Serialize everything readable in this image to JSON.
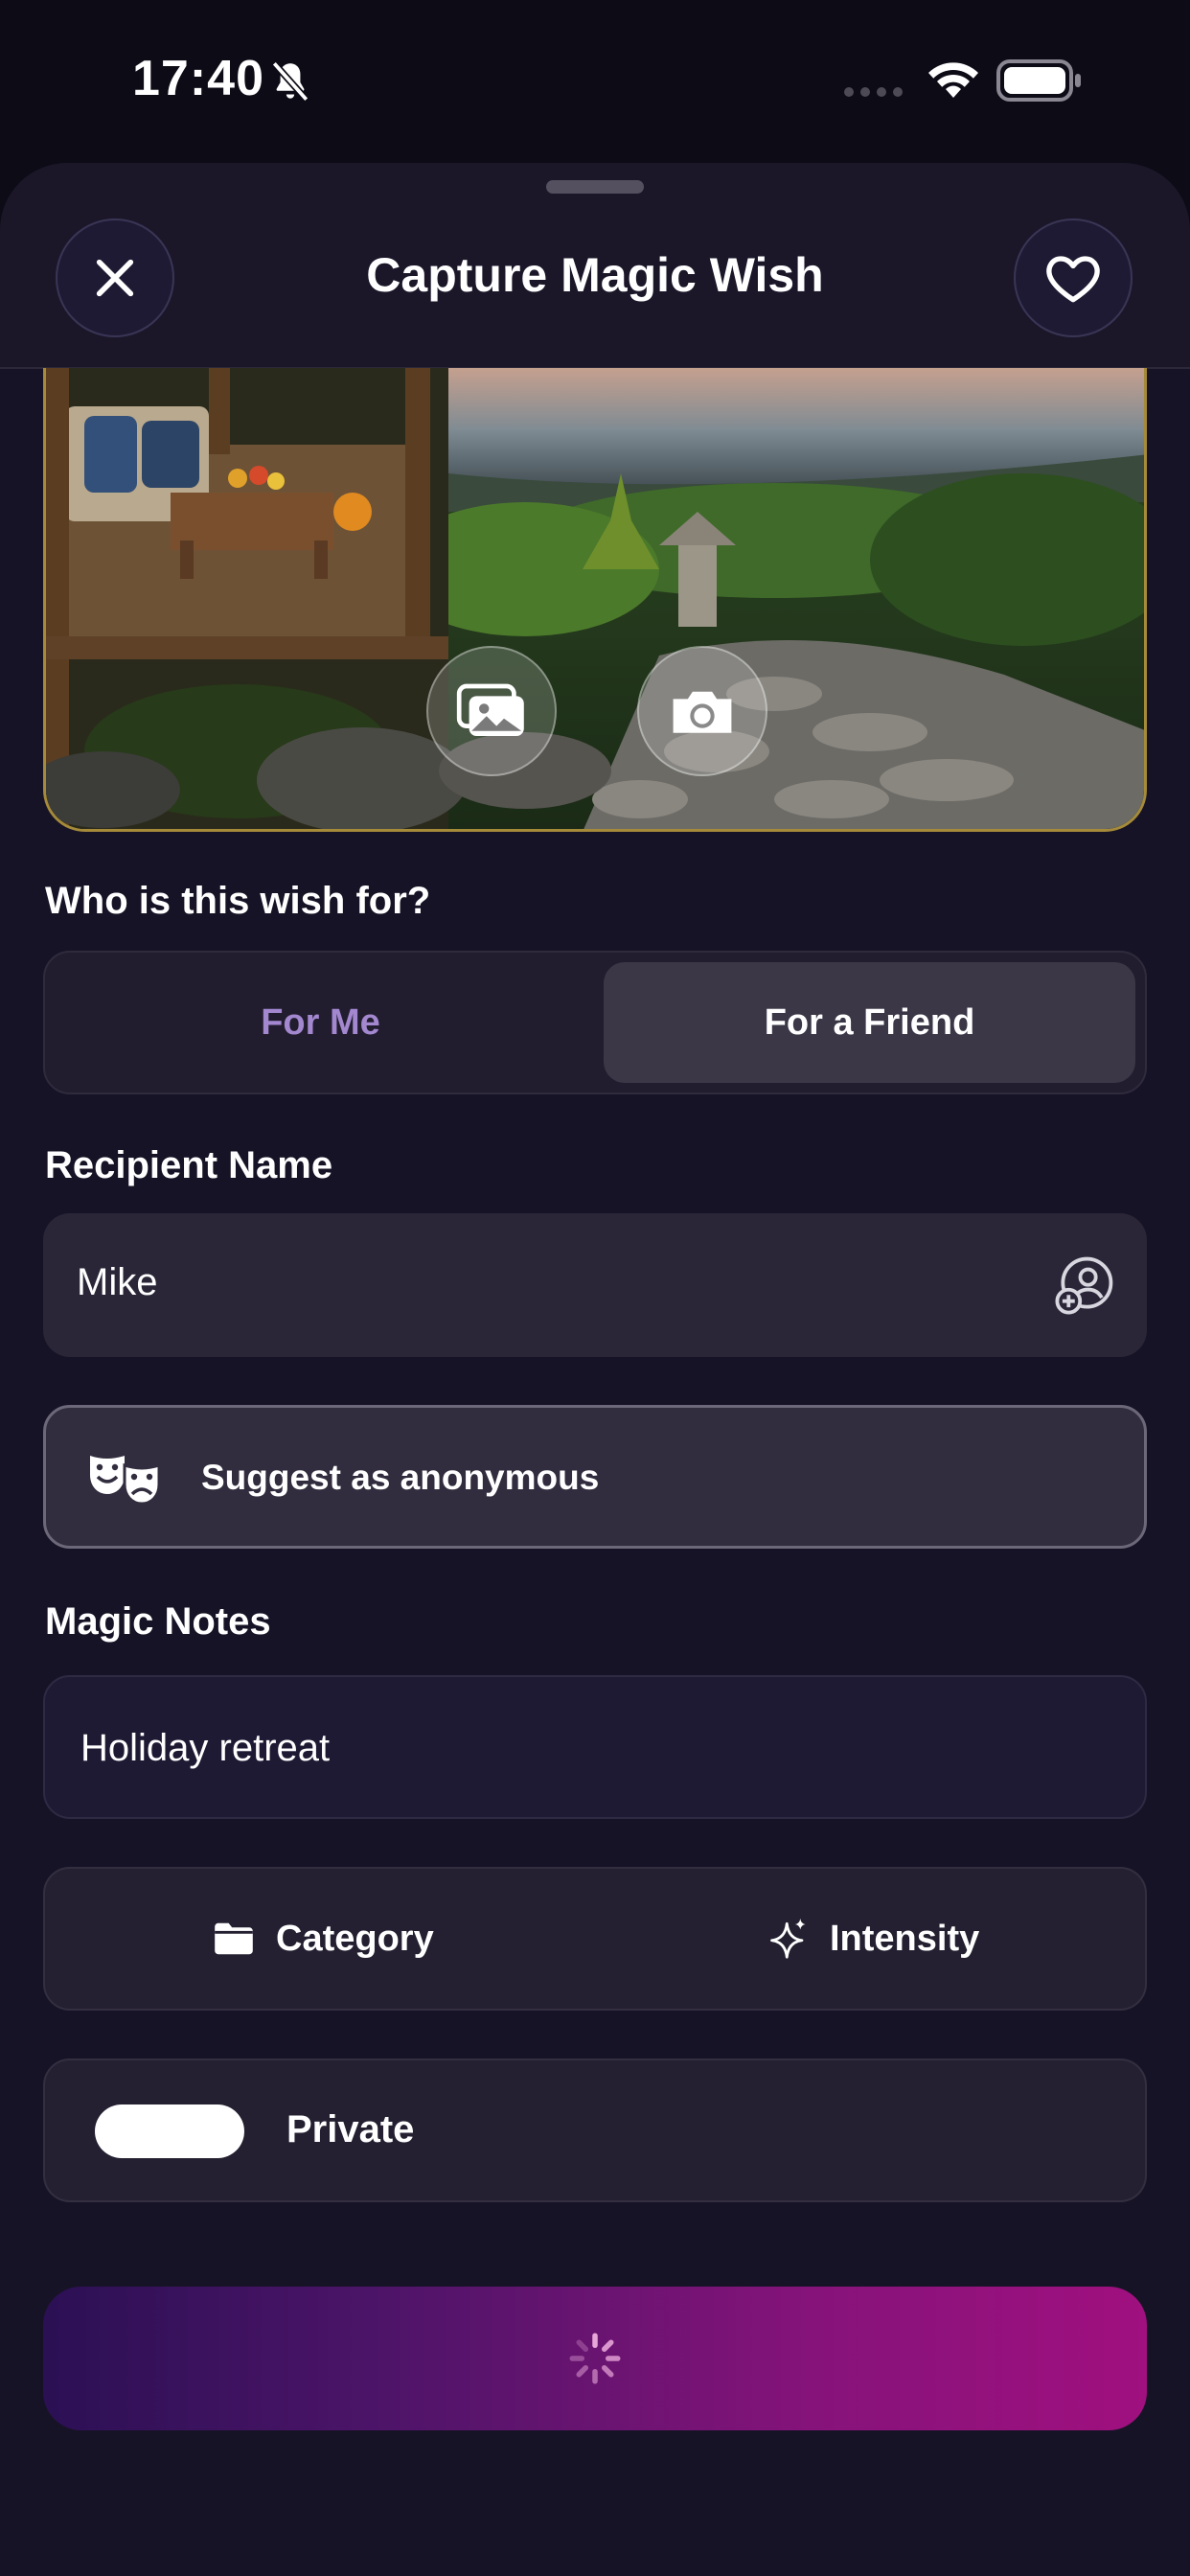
{
  "status_bar": {
    "time": "17:40",
    "icons": [
      "bell-slash-icon",
      "cellular-icon",
      "wifi-icon",
      "battery-icon"
    ]
  },
  "header": {
    "title": "Capture Magic Wish",
    "close_icon": "close-icon",
    "favorite_icon": "heart-icon"
  },
  "photo": {
    "gallery_icon": "photo-gallery-icon",
    "camera_icon": "camera-icon"
  },
  "recipient_type": {
    "label": "Who is this wish for?",
    "options": [
      "For Me",
      "For a Friend"
    ],
    "selected": "For a Friend"
  },
  "recipient": {
    "label": "Recipient Name",
    "value": "Mike",
    "icon": "add-contact-icon"
  },
  "anonymous": {
    "label": "Suggest as anonymous",
    "icon": "theater-masks-icon"
  },
  "notes": {
    "label": "Magic Notes",
    "value": "Holiday retreat"
  },
  "attributes": {
    "category_label": "Category",
    "category_icon": "folder-icon",
    "intensity_label": "Intensity",
    "intensity_icon": "sparkle-icon"
  },
  "privacy": {
    "label": "Private",
    "toggle_on": false
  },
  "submit": {
    "state": "loading",
    "icon": "spinner-icon"
  },
  "colors": {
    "background": "#171326",
    "accent_purple": "#a387cf",
    "gradient_start": "#2b1054",
    "gradient_end": "#a0107f",
    "photo_border": "#a58a3a"
  }
}
